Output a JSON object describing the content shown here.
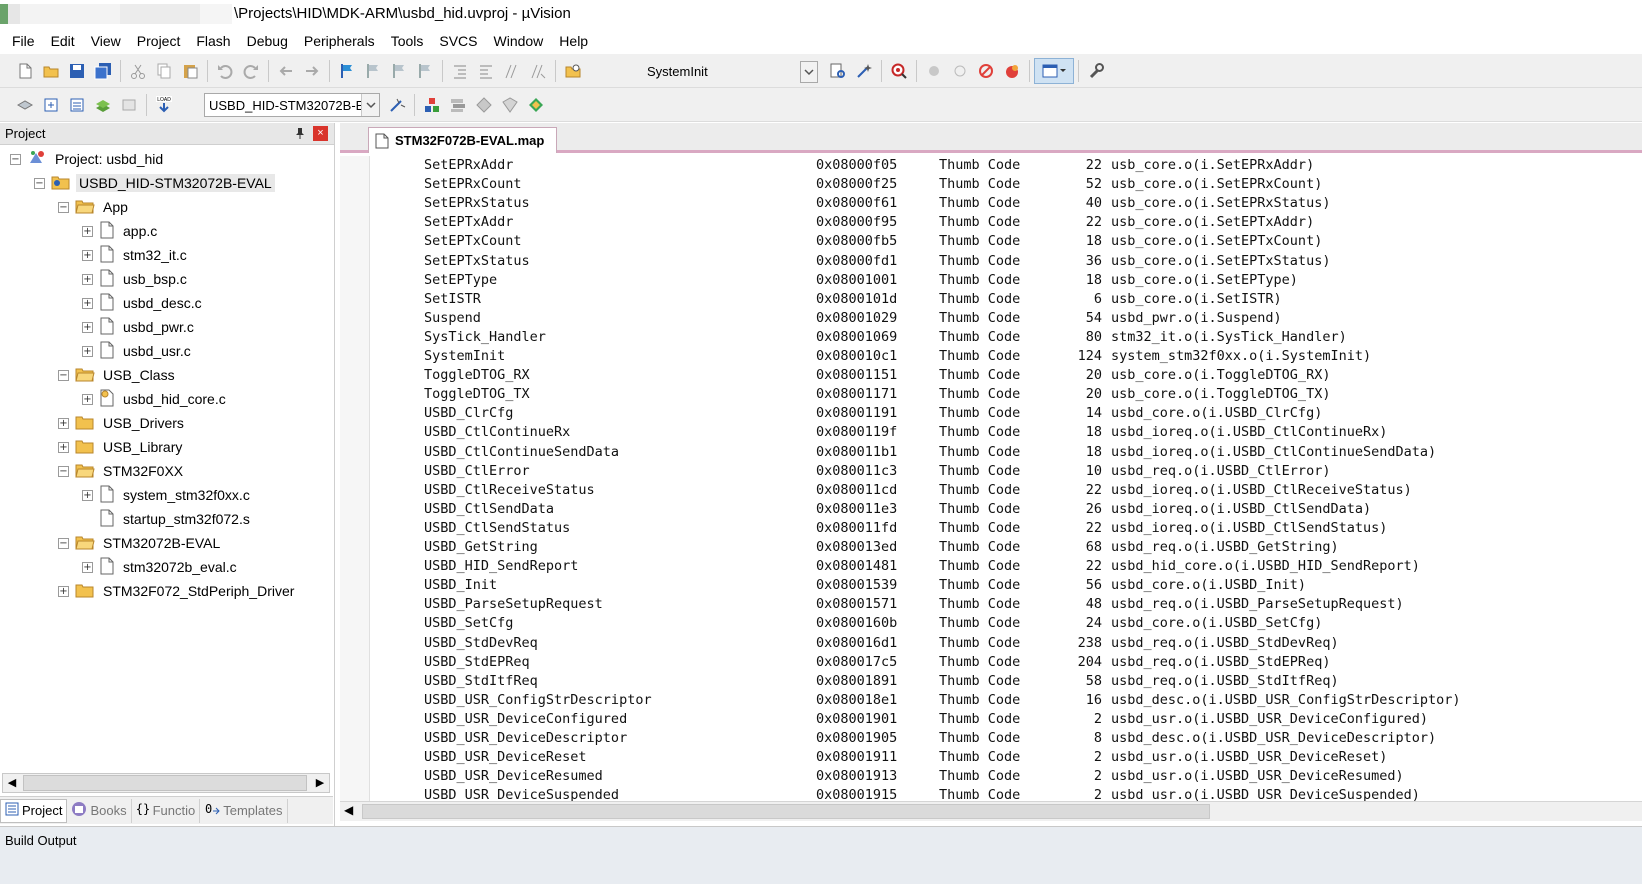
{
  "window": {
    "title": "\\Projects\\HID\\MDK-ARM\\usbd_hid.uvproj - µVision"
  },
  "menu": [
    "File",
    "Edit",
    "View",
    "Project",
    "Flash",
    "Debug",
    "Peripherals",
    "Tools",
    "SVCS",
    "Window",
    "Help"
  ],
  "toolbar1": {
    "function_combo": "SystemInit"
  },
  "toolbar2": {
    "target_combo": "USBD_HID-STM32072B-E"
  },
  "project_panel": {
    "title": "Project",
    "close_label": "×",
    "tree": [
      {
        "label": "Project: usbd_hid",
        "level": 0,
        "expander": "⊟",
        "icon": "project-icon"
      },
      {
        "label": "USBD_HID-STM32072B-EVAL",
        "level": 1,
        "expander": "⊟",
        "icon": "target-folder-icon"
      },
      {
        "label": "App",
        "level": 2,
        "expander": "⊟",
        "icon": "folder-open-icon"
      },
      {
        "label": "app.c",
        "level": 3,
        "expander": "⊞",
        "icon": "file-icon"
      },
      {
        "label": "stm32_it.c",
        "level": 3,
        "expander": "⊞",
        "icon": "file-icon"
      },
      {
        "label": "usb_bsp.c",
        "level": 3,
        "expander": "⊞",
        "icon": "file-icon"
      },
      {
        "label": "usbd_desc.c",
        "level": 3,
        "expander": "⊞",
        "icon": "file-icon"
      },
      {
        "label": "usbd_pwr.c",
        "level": 3,
        "expander": "⊞",
        "icon": "file-icon"
      },
      {
        "label": "usbd_usr.c",
        "level": 3,
        "expander": "⊞",
        "icon": "file-icon"
      },
      {
        "label": "USB_Class",
        "level": 2,
        "expander": "⊟",
        "icon": "folder-open-icon"
      },
      {
        "label": "usbd_hid_core.c",
        "level": 3,
        "expander": "⊞",
        "icon": "file-key-icon"
      },
      {
        "label": "USB_Drivers",
        "level": 2,
        "expander": "⊞",
        "icon": "folder-icon"
      },
      {
        "label": "USB_Library",
        "level": 2,
        "expander": "⊞",
        "icon": "folder-icon"
      },
      {
        "label": "STM32F0XX",
        "level": 2,
        "expander": "⊟",
        "icon": "folder-open-icon"
      },
      {
        "label": "system_stm32f0xx.c",
        "level": 3,
        "expander": "⊞",
        "icon": "file-icon"
      },
      {
        "label": "startup_stm32f072.s",
        "level": 3,
        "expander": "",
        "icon": "file-icon"
      },
      {
        "label": "STM32072B-EVAL",
        "level": 2,
        "expander": "⊟",
        "icon": "folder-open-icon"
      },
      {
        "label": "stm32072b_eval.c",
        "level": 3,
        "expander": "⊞",
        "icon": "file-icon"
      },
      {
        "label": "STM32F072_StdPeriph_Driver",
        "level": 2,
        "expander": "⊞",
        "icon": "folder-icon"
      }
    ],
    "bottom_tabs": [
      {
        "label": "Project",
        "icon": "project-tab-icon",
        "active": true
      },
      {
        "label": "Books",
        "icon": "books-icon",
        "active": false
      },
      {
        "label": "Functio",
        "icon": "functions-icon",
        "active": false
      },
      {
        "label": "Templates",
        "icon": "templates-icon",
        "active": false
      }
    ]
  },
  "editor": {
    "tab_label": "STM32F072B-EVAL.map",
    "rows": [
      [
        "SetEPRxAddr",
        "0x08000f05",
        "Thumb Code",
        "22",
        "usb_core.o(i.SetEPRxAddr)"
      ],
      [
        "SetEPRxCount",
        "0x08000f25",
        "Thumb Code",
        "52",
        "usb_core.o(i.SetEPRxCount)"
      ],
      [
        "SetEPRxStatus",
        "0x08000f61",
        "Thumb Code",
        "40",
        "usb_core.o(i.SetEPRxStatus)"
      ],
      [
        "SetEPTxAddr",
        "0x08000f95",
        "Thumb Code",
        "22",
        "usb_core.o(i.SetEPTxAddr)"
      ],
      [
        "SetEPTxCount",
        "0x08000fb5",
        "Thumb Code",
        "18",
        "usb_core.o(i.SetEPTxCount)"
      ],
      [
        "SetEPTxStatus",
        "0x08000fd1",
        "Thumb Code",
        "36",
        "usb_core.o(i.SetEPTxStatus)"
      ],
      [
        "SetEPType",
        "0x08001001",
        "Thumb Code",
        "18",
        "usb_core.o(i.SetEPType)"
      ],
      [
        "SetISTR",
        "0x0800101d",
        "Thumb Code",
        "6",
        "usb_core.o(i.SetISTR)"
      ],
      [
        "Suspend",
        "0x08001029",
        "Thumb Code",
        "54",
        "usbd_pwr.o(i.Suspend)"
      ],
      [
        "SysTick_Handler",
        "0x08001069",
        "Thumb Code",
        "80",
        "stm32_it.o(i.SysTick_Handler)"
      ],
      [
        "SystemInit",
        "0x080010c1",
        "Thumb Code",
        "124",
        "system_stm32f0xx.o(i.SystemInit)"
      ],
      [
        "ToggleDTOG_RX",
        "0x08001151",
        "Thumb Code",
        "20",
        "usb_core.o(i.ToggleDTOG_RX)"
      ],
      [
        "ToggleDTOG_TX",
        "0x08001171",
        "Thumb Code",
        "20",
        "usb_core.o(i.ToggleDTOG_TX)"
      ],
      [
        "USBD_ClrCfg",
        "0x08001191",
        "Thumb Code",
        "14",
        "usbd_core.o(i.USBD_ClrCfg)"
      ],
      [
        "USBD_CtlContinueRx",
        "0x0800119f",
        "Thumb Code",
        "18",
        "usbd_ioreq.o(i.USBD_CtlContinueRx)"
      ],
      [
        "USBD_CtlContinueSendData",
        "0x080011b1",
        "Thumb Code",
        "18",
        "usbd_ioreq.o(i.USBD_CtlContinueSendData)"
      ],
      [
        "USBD_CtlError",
        "0x080011c3",
        "Thumb Code",
        "10",
        "usbd_req.o(i.USBD_CtlError)"
      ],
      [
        "USBD_CtlReceiveStatus",
        "0x080011cd",
        "Thumb Code",
        "22",
        "usbd_ioreq.o(i.USBD_CtlReceiveStatus)"
      ],
      [
        "USBD_CtlSendData",
        "0x080011e3",
        "Thumb Code",
        "26",
        "usbd_ioreq.o(i.USBD_CtlSendData)"
      ],
      [
        "USBD_CtlSendStatus",
        "0x080011fd",
        "Thumb Code",
        "22",
        "usbd_ioreq.o(i.USBD_CtlSendStatus)"
      ],
      [
        "USBD_GetString",
        "0x080013ed",
        "Thumb Code",
        "68",
        "usbd_req.o(i.USBD_GetString)"
      ],
      [
        "USBD_HID_SendReport",
        "0x08001481",
        "Thumb Code",
        "22",
        "usbd_hid_core.o(i.USBD_HID_SendReport)"
      ],
      [
        "USBD_Init",
        "0x08001539",
        "Thumb Code",
        "56",
        "usbd_core.o(i.USBD_Init)"
      ],
      [
        "USBD_ParseSetupRequest",
        "0x08001571",
        "Thumb Code",
        "48",
        "usbd_req.o(i.USBD_ParseSetupRequest)"
      ],
      [
        "USBD_SetCfg",
        "0x0800160b",
        "Thumb Code",
        "24",
        "usbd_core.o(i.USBD_SetCfg)"
      ],
      [
        "USBD_StdDevReq",
        "0x080016d1",
        "Thumb Code",
        "238",
        "usbd_req.o(i.USBD_StdDevReq)"
      ],
      [
        "USBD_StdEPReq",
        "0x080017c5",
        "Thumb Code",
        "204",
        "usbd_req.o(i.USBD_StdEPReq)"
      ],
      [
        "USBD_StdItfReq",
        "0x08001891",
        "Thumb Code",
        "58",
        "usbd_req.o(i.USBD_StdItfReq)"
      ],
      [
        "USBD_USR_ConfigStrDescriptor",
        "0x080018e1",
        "Thumb Code",
        "16",
        "usbd_desc.o(i.USBD_USR_ConfigStrDescriptor)"
      ],
      [
        "USBD_USR_DeviceConfigured",
        "0x08001901",
        "Thumb Code",
        "2",
        "usbd_usr.o(i.USBD_USR_DeviceConfigured)"
      ],
      [
        "USBD_USR_DeviceDescriptor",
        "0x08001905",
        "Thumb Code",
        "8",
        "usbd_desc.o(i.USBD_USR_DeviceDescriptor)"
      ],
      [
        "USBD_USR_DeviceReset",
        "0x08001911",
        "Thumb Code",
        "2",
        "usbd_usr.o(i.USBD_USR_DeviceReset)"
      ],
      [
        "USBD_USR_DeviceResumed",
        "0x08001913",
        "Thumb Code",
        "2",
        "usbd_usr.o(i.USBD_USR_DeviceResumed)"
      ],
      [
        "USBD_USR_DeviceSuspended",
        "0x08001915",
        "Thumb Code",
        "2",
        "usbd_usr.o(i.USBD_USR_DeviceSuspended)"
      ]
    ]
  },
  "build_output": {
    "title": "Build Output"
  },
  "colors": {
    "tab_accent": "#d9a8c2",
    "close_red": "#d9342b",
    "folder_yellow": "#f2c14e"
  }
}
